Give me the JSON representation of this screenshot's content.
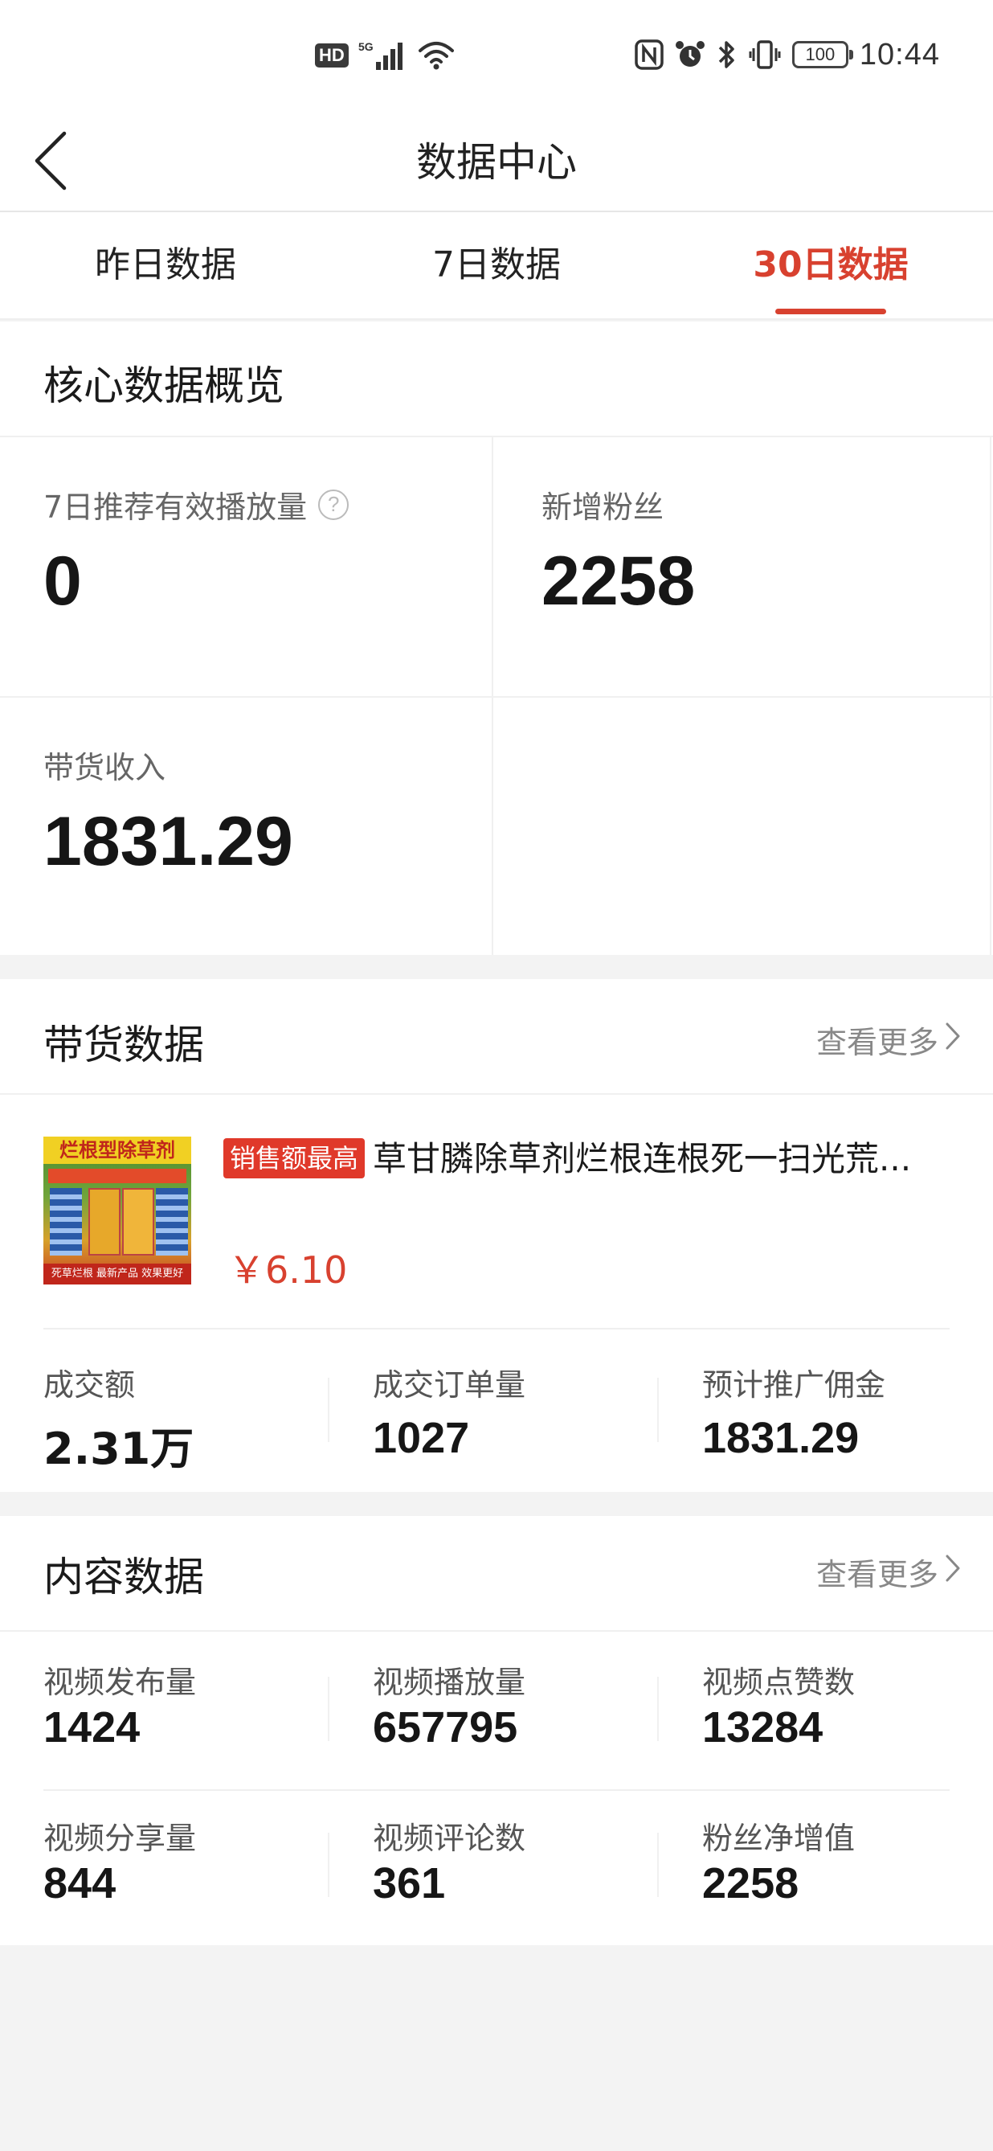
{
  "status_bar": {
    "hd": "HD",
    "network": "5G",
    "battery": "100",
    "time": "10:44",
    "icons": [
      "signal-icon",
      "wifi-icon",
      "nfc-icon",
      "alarm-icon",
      "bluetooth-icon",
      "vibrate-icon",
      "battery-icon"
    ]
  },
  "header": {
    "title": "数据中心",
    "back_icon": "chevron-left-icon"
  },
  "tabs": [
    {
      "label": "昨日数据",
      "active": false
    },
    {
      "label": "7日数据",
      "active": false
    },
    {
      "label": "30日数据",
      "active": true
    }
  ],
  "core_overview": {
    "title": "核心数据概览",
    "metrics": [
      {
        "label": "7日推荐有效播放量",
        "value": "0",
        "has_help_icon": true
      },
      {
        "label": "新增粉丝",
        "value": "2258"
      },
      {
        "label": "带货收入",
        "value": "1831.29"
      }
    ]
  },
  "sales_data": {
    "title": "带货数据",
    "see_more": "查看更多",
    "product": {
      "badge": "销售额最高",
      "name": "草甘膦除草剂烂根连根死一扫光荒...",
      "price": "￥6.10",
      "thumb_banner": "烂根型除草剂",
      "thumb_footer": "死草烂根 最新产品 效果更好"
    },
    "stats": [
      {
        "label": "成交额",
        "value": "2.31万"
      },
      {
        "label": "成交订单量",
        "value": "1027"
      },
      {
        "label": "预计推广佣金",
        "value": "1831.29"
      }
    ]
  },
  "content_data": {
    "title": "内容数据",
    "see_more": "查看更多",
    "stats": [
      {
        "label": "视频发布量",
        "value": "1424"
      },
      {
        "label": "视频播放量",
        "value": "657795"
      },
      {
        "label": "视频点赞数",
        "value": "13284"
      },
      {
        "label": "视频分享量",
        "value": "844"
      },
      {
        "label": "视频评论数",
        "value": "361"
      },
      {
        "label": "粉丝净增值",
        "value": "2258"
      }
    ]
  },
  "colors": {
    "accent": "#d8412f",
    "background": "#f3f3f3",
    "card": "#ffffff"
  }
}
